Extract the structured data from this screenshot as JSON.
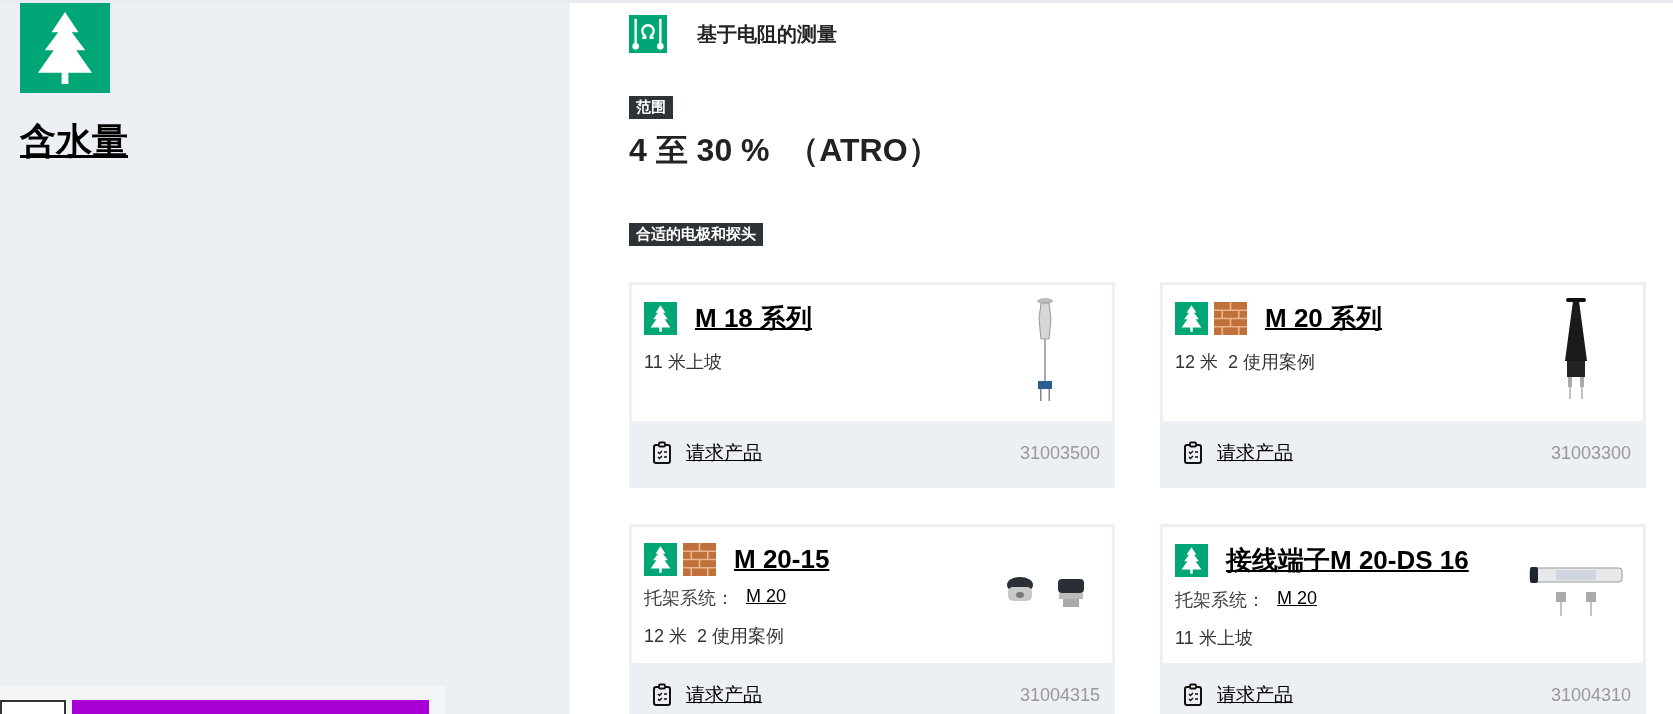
{
  "sidebar": {
    "material_icon": {
      "kind": "wood"
    },
    "title": "含水量"
  },
  "method": {
    "title": "基于电阻的测量"
  },
  "range": {
    "tag": "范围",
    "value": "4 至 30 %  （ATRO）"
  },
  "probes_tag": "合适的电极和探头",
  "products": [
    {
      "materials": [
        {
          "kind": "wood"
        }
      ],
      "name": "M 18 系列",
      "specs": [
        "11 米上坡"
      ],
      "kind": "pin-probe",
      "request": "请求产品",
      "number": "31003500"
    },
    {
      "materials": [
        {
          "kind": "wood"
        },
        {
          "kind": "brick"
        }
      ],
      "name": "M 20 系列",
      "specs": [
        "12 米",
        "2 使用案例"
      ],
      "kind": "handle-probe",
      "request": "请求产品",
      "number": "31003300"
    },
    {
      "materials": [
        {
          "kind": "wood"
        },
        {
          "kind": "brick"
        }
      ],
      "name": "M 20-15",
      "holder": {
        "label": "托架系统：",
        "link": "M 20"
      },
      "specs": [
        "12 米",
        "2 使用案例"
      ],
      "kind": "caps",
      "request": "请求产品",
      "number": "31004315"
    },
    {
      "materials": [
        {
          "kind": "wood"
        }
      ],
      "name": "接线端子M 20-DS 16",
      "holder": {
        "label": "托架系统：",
        "link": "M 20"
      },
      "specs": [
        "11 米上坡"
      ],
      "kind": "tube",
      "request": "请求产品",
      "number": "31004310"
    }
  ]
}
